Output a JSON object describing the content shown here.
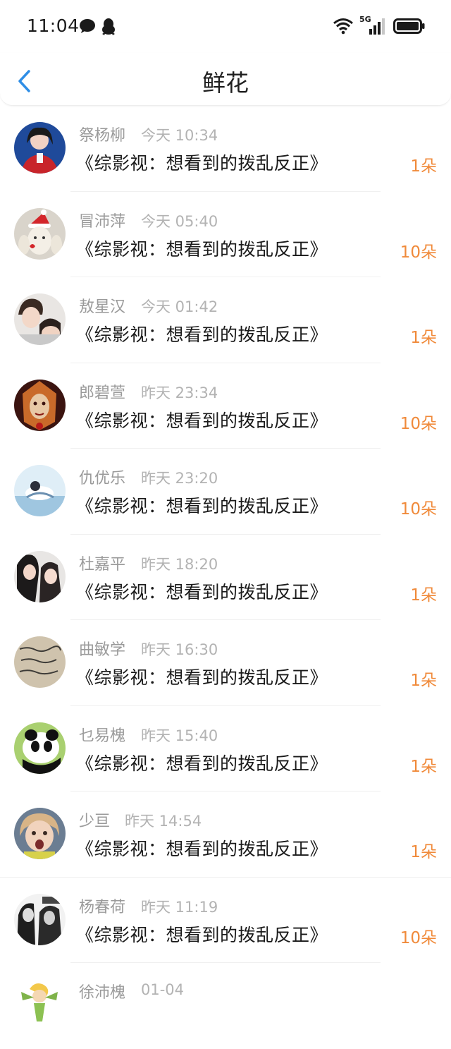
{
  "status": {
    "time": "11:04",
    "network": "5G"
  },
  "header": {
    "title": "鲜花"
  },
  "colors": {
    "count": "#f08a3a",
    "back": "#2f8ee6",
    "meta": "#9a9a9a"
  },
  "items": [
    {
      "name": "祭杨柳",
      "time": "今天 10:34",
      "work": "《综影视：想看到的拨乱反正》",
      "count": "1朵"
    },
    {
      "name": "冒沛萍",
      "time": "今天 05:40",
      "work": "《综影视：想看到的拨乱反正》",
      "count": "10朵"
    },
    {
      "name": "敖星汉",
      "time": "今天 01:42",
      "work": "《综影视：想看到的拨乱反正》",
      "count": "1朵"
    },
    {
      "name": "郎碧萱",
      "time": "昨天 23:34",
      "work": "《综影视：想看到的拨乱反正》",
      "count": "10朵"
    },
    {
      "name": "仇优乐",
      "time": "昨天 23:20",
      "work": "《综影视：想看到的拨乱反正》",
      "count": "10朵"
    },
    {
      "name": "杜嘉平",
      "time": "昨天 18:20",
      "work": "《综影视：想看到的拨乱反正》",
      "count": "1朵"
    },
    {
      "name": "曲敏学",
      "time": "昨天 16:30",
      "work": "《综影视：想看到的拨乱反正》",
      "count": "1朵"
    },
    {
      "name": "乜易槐",
      "time": "昨天 15:40",
      "work": "《综影视：想看到的拨乱反正》",
      "count": "1朵"
    },
    {
      "name": "少亘",
      "time": "昨天 14:54",
      "work": "《综影视：想看到的拨乱反正》",
      "count": "1朵"
    },
    {
      "name": "杨春荷",
      "time": "昨天 11:19",
      "work": "《综影视：想看到的拨乱反正》",
      "count": "10朵"
    },
    {
      "name": "徐沛槐",
      "time": "01-04",
      "work": "",
      "count": ""
    }
  ]
}
